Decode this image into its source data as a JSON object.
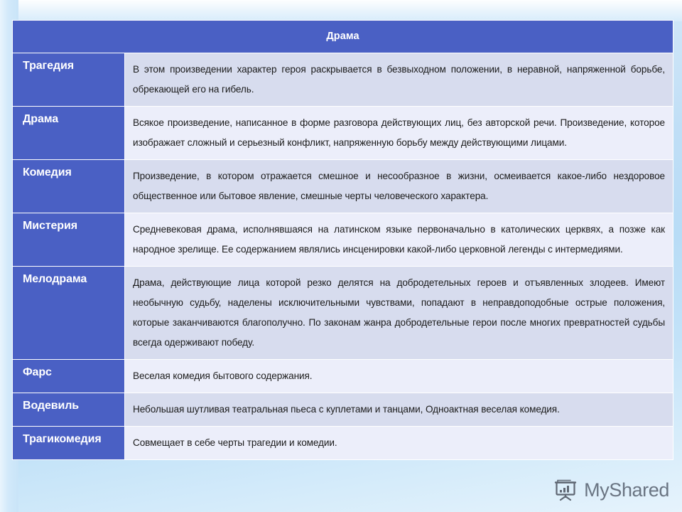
{
  "slide": {
    "title": "Драма",
    "accent_color": "#4a60c4",
    "row_shade_dark": "#d7dcee",
    "row_shade_light": "#eceefa",
    "background_color": "#bfdef6"
  },
  "table": {
    "header": "Драма",
    "rows": [
      {
        "term": "Трагедия",
        "definition": "В этом произведении характер героя раскрывается в безвыходном положении, в неравной, напряженной борьбе, обрекающей его на гибель."
      },
      {
        "term": "Драма",
        "definition": "Всякое произведение, написанное в форме разговора действующих лиц, без авторской речи. Произведение, которое изображает сложный и серьезный конфликт, напряженную борьбу между действующими лицами."
      },
      {
        "term": "Комедия",
        "definition": "Произведение, в котором отражается смешное и несообразное в жизни, осмеивается какое-либо нездоровое общественное или бытовое явление, смешные черты человеческого характера."
      },
      {
        "term": "Мистерия",
        "definition": "Средневековая драма, исполнявшаяся на латинском языке первоначально в католических церквях, а позже как народное зрелище. Ее содержанием являлись инсценировки какой-либо церковной легенды с интермедиями."
      },
      {
        "term": "Мелодрама",
        "definition": "Драма, действующие лица которой резко делятся на добродетельных героев и отъявленных злодеев. Имеют необычную судьбу, наделены исключительными чувствами, попадают в неправдоподобные острые положения, которые заканчиваются благополучно. По законам жанра добродетельные герои после многих превратностей судьбы всегда одерживают победу."
      },
      {
        "term": "Фарс",
        "definition": "Веселая комедия бытового содержания."
      },
      {
        "term": "Водевиль",
        "definition": "Небольшая шутливая театральная пьеса с куплетами и танцами, Одноактная веселая комедия."
      },
      {
        "term": "Трагикомедия",
        "definition": "Совмещает в себе черты трагедии и комедии."
      }
    ]
  },
  "watermark": {
    "label": "MyShared",
    "icon": "flipchart-chart-icon"
  }
}
